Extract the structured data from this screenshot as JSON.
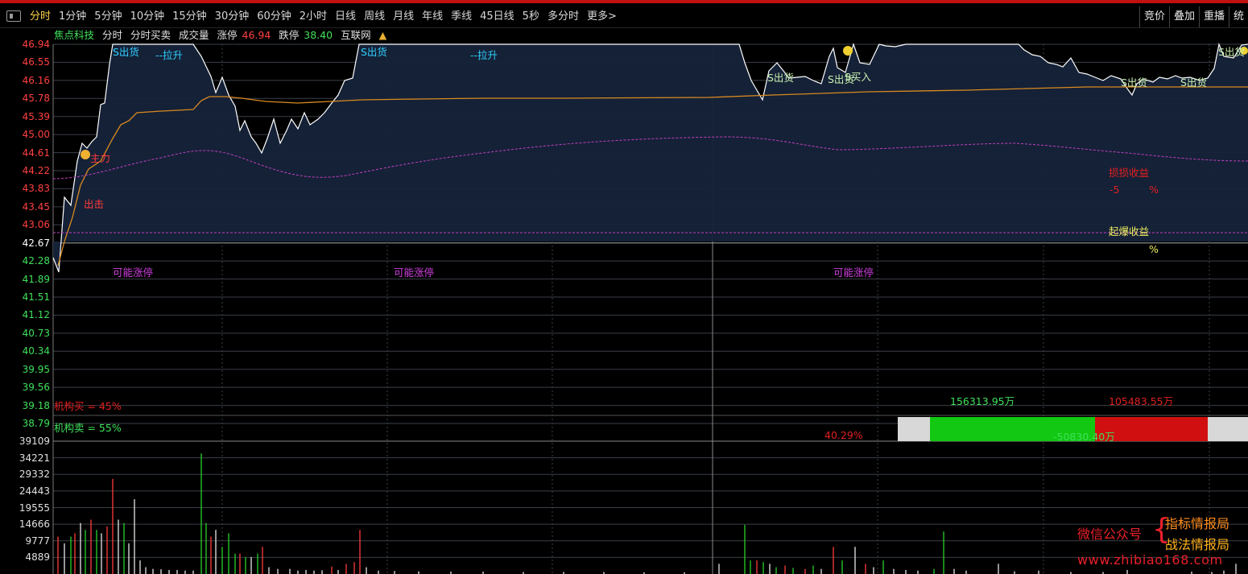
{
  "toolbar": {
    "periods": [
      "分时",
      "1分钟",
      "5分钟",
      "10分钟",
      "15分钟",
      "30分钟",
      "60分钟",
      "2小时",
      "日线",
      "周线",
      "月线",
      "年线",
      "季线",
      "45日线",
      "5秒",
      "多分时",
      "更多>"
    ],
    "active_index": 0,
    "right_buttons": [
      "竞价",
      "叠加",
      "重播",
      "统"
    ]
  },
  "info_bar": {
    "stock_name": "焦点科技",
    "view_items": [
      "分时",
      "分时买卖",
      "成交量"
    ],
    "limit_up_label": "涨停",
    "limit_up_value": "46.94",
    "limit_down_label": "跌停",
    "limit_down_value": "38.40",
    "concept": "互联网",
    "concept_icon": "up-down-arrow-icon"
  },
  "price_axis": {
    "ticks": [
      "46.94",
      "46.55",
      "46.16",
      "45.78",
      "45.39",
      "45.00",
      "44.61",
      "44.22",
      "43.83",
      "43.45",
      "43.06",
      "42.67",
      "42.28",
      "41.89",
      "41.51",
      "41.12",
      "40.73",
      "40.34",
      "39.95",
      "39.56",
      "39.18",
      "38.79"
    ],
    "prev_close": "42.67",
    "max": 46.94,
    "min": 38.79
  },
  "volume_axis": {
    "ticks": [
      "39109",
      "34221",
      "29332",
      "24443",
      "19555",
      "14666",
      "9777",
      "4889"
    ],
    "max": 39109
  },
  "chart_labels": {
    "s_sell": "S出货",
    "pull_up": "--拉升",
    "main_force": "主力",
    "attack": "出击",
    "buy": "S买入",
    "possible_limit_up": "可能涨停",
    "stop_loss_title": "损损收益",
    "stop_loss_value": "-5",
    "stop_loss_unit": "%",
    "burst_title": "起爆收益",
    "burst_unit": "%",
    "inst_buy": "机构买 = 45%",
    "inst_sell": "机构卖 = 55%",
    "buy_amount": "156313.95万",
    "sell_amount": "105483.55万",
    "net_amount": "-50830.40万",
    "net_pct": "40.29%"
  },
  "colors": {
    "up": "#ff3b3b",
    "down": "#29d129",
    "price_line": "#ffffff",
    "avg_line": "#d98a1f",
    "wave_line": "#c040c0",
    "label_magenta": "#d040e0",
    "label_cyan": "#2fd0ff"
  },
  "watermark": {
    "wechat": "微信公众号",
    "line1": "指标情报局",
    "line2": "战法情报局",
    "url": "www.zhibiao168.com"
  }
}
